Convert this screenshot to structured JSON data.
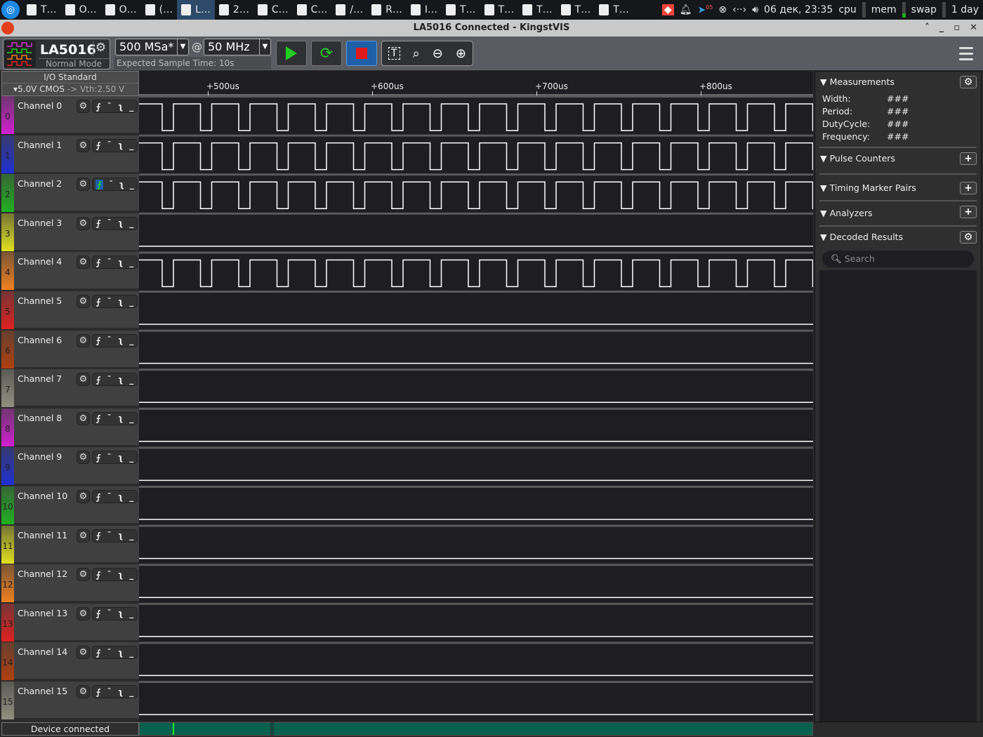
{
  "taskbar": {
    "items": [
      {
        "label": "T…",
        "active": false
      },
      {
        "label": "O…",
        "active": false
      },
      {
        "label": "O…",
        "active": false
      },
      {
        "label": "(…",
        "active": false
      },
      {
        "label": "L…",
        "active": true
      },
      {
        "label": "2…",
        "active": false
      },
      {
        "label": "C…",
        "active": false
      },
      {
        "label": "C…",
        "active": false
      },
      {
        "label": "/…",
        "active": false
      },
      {
        "label": "R…",
        "active": false
      },
      {
        "label": "I…",
        "active": false
      },
      {
        "label": "T…",
        "active": false
      },
      {
        "label": "T…",
        "active": false
      },
      {
        "label": "T…",
        "active": false
      },
      {
        "label": "T…",
        "active": false
      },
      {
        "label": "T…",
        "active": false
      }
    ],
    "clock": "06 дек, 23:35",
    "cpu": "cpu",
    "mem": "mem",
    "swap": "swap",
    "uptime": "1 day",
    "telegram_badge": "05"
  },
  "window": {
    "title": "LA5016 Connected - KingstVIS"
  },
  "toolbar": {
    "device": "LA5016",
    "mode": "Normal Mode",
    "sample_rate": "500 MSa*",
    "at": "@",
    "frequency": "50 MHz",
    "expected_time": "Expected Sample Time: 10s"
  },
  "io": {
    "title": "I/O Standard",
    "standard": "5.0V CMOS",
    "threshold": "-> Vth:2.50 V"
  },
  "ruler": {
    "ticks": [
      "+500us",
      "+600us",
      "+700us",
      "+800us"
    ]
  },
  "channels": [
    {
      "name": "Channel 0",
      "num": "0",
      "active": true,
      "color": "#d020d0",
      "trig": false
    },
    {
      "name": "Channel 1",
      "num": "1",
      "active": true,
      "color": "#2030d0",
      "trig": false
    },
    {
      "name": "Channel 2",
      "num": "2",
      "active": true,
      "color": "#20b020",
      "trig": true
    },
    {
      "name": "Channel 3",
      "num": "3",
      "active": false,
      "color": "#e0e020",
      "trig": false
    },
    {
      "name": "Channel 4",
      "num": "4",
      "active": true,
      "color": "#f08020",
      "trig": false
    },
    {
      "name": "Channel 5",
      "num": "5",
      "active": false,
      "color": "#e02020",
      "trig": false
    },
    {
      "name": "Channel 6",
      "num": "6",
      "active": false,
      "color": "#b04010",
      "trig": false
    },
    {
      "name": "Channel 7",
      "num": "7",
      "active": false,
      "color": "#909080",
      "trig": false
    },
    {
      "name": "Channel 8",
      "num": "8",
      "active": false,
      "color": "#d020d0",
      "trig": false
    },
    {
      "name": "Channel 9",
      "num": "9",
      "active": false,
      "color": "#2030d0",
      "trig": false
    },
    {
      "name": "Channel 10",
      "num": "10",
      "active": false,
      "color": "#20b020",
      "trig": false
    },
    {
      "name": "Channel 11",
      "num": "11",
      "active": false,
      "color": "#e0e020",
      "trig": false
    },
    {
      "name": "Channel 12",
      "num": "12",
      "active": false,
      "color": "#f08020",
      "trig": false
    },
    {
      "name": "Channel 13",
      "num": "13",
      "active": false,
      "color": "#e02020",
      "trig": false
    },
    {
      "name": "Channel 14",
      "num": "14",
      "active": false,
      "color": "#b04010",
      "trig": false
    },
    {
      "name": "Channel 15",
      "num": "15",
      "active": false,
      "color": "#909080",
      "trig": false
    }
  ],
  "panel": {
    "measurements": {
      "title": "Measurements",
      "rows": [
        {
          "label": "Width:",
          "value": "###"
        },
        {
          "label": "Period:",
          "value": "###"
        },
        {
          "label": "DutyCycle:",
          "value": "###"
        },
        {
          "label": "Frequency:",
          "value": "###"
        }
      ]
    },
    "pulse_counters": "Pulse Counters",
    "timing_markers": "Timing Marker Pairs",
    "analyzers": "Analyzers",
    "decoded": "Decoded Results",
    "search_placeholder": "Search"
  },
  "status": "Device connected"
}
